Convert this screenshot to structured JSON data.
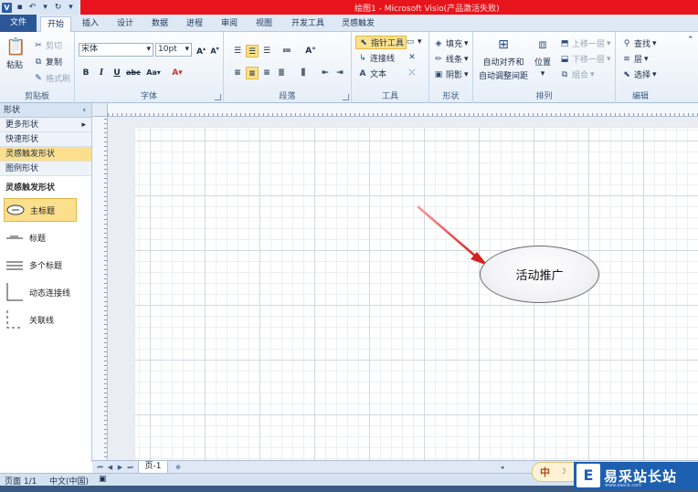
{
  "window": {
    "title": "绘图1 - Microsoft Visio(产品激活失败)"
  },
  "tabs": [
    "文件",
    "开始",
    "插入",
    "设计",
    "数据",
    "进程",
    "审阅",
    "视图",
    "开发工具",
    "灵感触发"
  ],
  "ribbon": {
    "clipboard": {
      "paste": "粘贴",
      "cut": "剪切",
      "copy": "复制",
      "format_painter": "格式刷",
      "label": "剪贴板"
    },
    "font": {
      "name": "宋体",
      "size": "10pt",
      "label": "字体"
    },
    "paragraph": {
      "label": "段落"
    },
    "tools": {
      "pointer": "指针工具",
      "connector": "连接线",
      "text": "文本",
      "label": "工具"
    },
    "shape": {
      "fill": "填充",
      "line": "线条",
      "shadow": "阴影",
      "label": "形状"
    },
    "arrange": {
      "auto_align": "自动对齐和",
      "auto_space": "自动调整间距",
      "position": "位置",
      "bring_forward": "上移一层",
      "send_backward": "下移一层",
      "group": "组合",
      "label": "排列"
    },
    "editing": {
      "find": "查找",
      "layers": "层",
      "select": "选择",
      "label": "编辑"
    }
  },
  "shapes_pane": {
    "header": "形状",
    "more_shapes": "更多形状",
    "quick_shapes": "快速形状",
    "stencils": [
      "灵感触发形状",
      "图例形状"
    ],
    "active_stencil": "灵感触发形状",
    "items": [
      "主标题",
      "标题",
      "多个标题",
      "动态连接线",
      "关联线"
    ]
  },
  "drawing": {
    "ellipse_text": "活动推广"
  },
  "page_tabs": [
    "页-1"
  ],
  "status": {
    "page": "页面 1/1",
    "language": "中文(中国)"
  },
  "overlay": {
    "ime": "中",
    "watermark": "易采站长站",
    "watermark_sub": "www.easck.com"
  },
  "colors": {
    "title_bar": "#e8141b",
    "file_tab": "#2b5797",
    "highlight": "#fcdf8c",
    "arrow": "#e03030"
  }
}
